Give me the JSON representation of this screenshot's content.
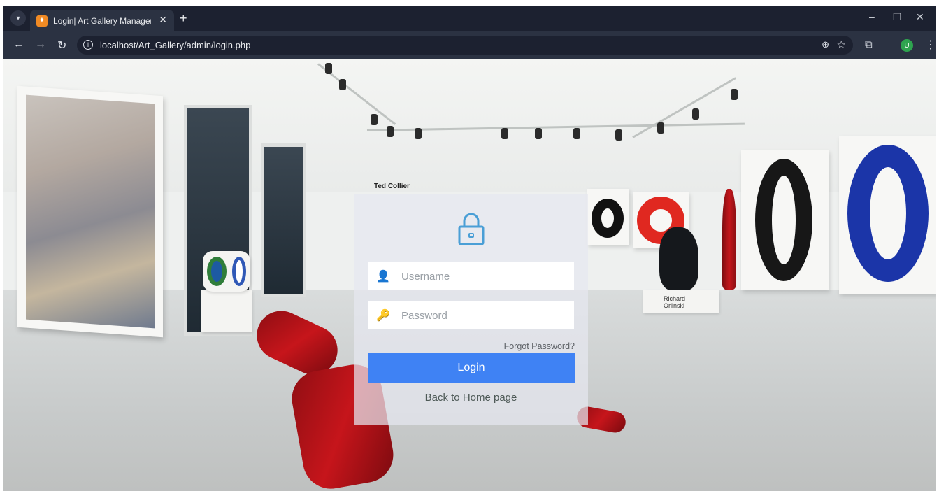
{
  "browser": {
    "tab_title": "Login| Art Gallery Management",
    "url": "localhost/Art_Gallery/admin/login.php",
    "profile_initial": "U",
    "colors": {
      "tabbar": "#1c2130",
      "toolbar": "#2b3242",
      "avatar": "#2ea44f"
    }
  },
  "backdrop": {
    "artist_label_1": "Ted Collier",
    "artist_label_2_line1": "Richard",
    "artist_label_2_line2": "Orlinski"
  },
  "login": {
    "username_placeholder": "Username",
    "password_placeholder": "Password",
    "forgot_password": "Forgot Password?",
    "login_button": "Login",
    "back_home": "Back to Home page",
    "colors": {
      "button": "#3f82f4",
      "lock_icon": "#4a9fd6"
    }
  }
}
